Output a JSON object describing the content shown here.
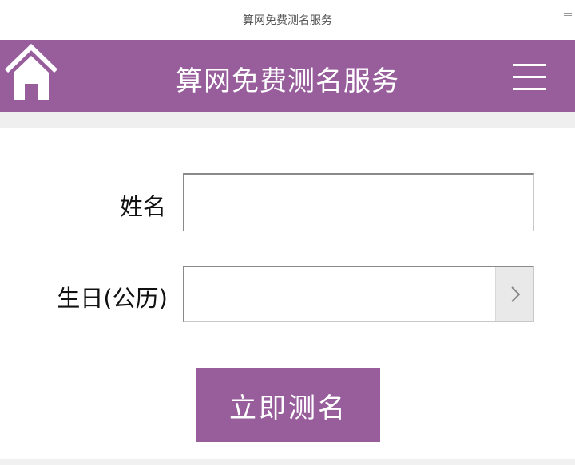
{
  "browser": {
    "title": "算网免费测名服务"
  },
  "header": {
    "title": "算网免费测名服务",
    "home_icon": "home-icon",
    "menu_icon": "hamburger-menu-icon",
    "color": "#985e9c"
  },
  "form": {
    "name_label": "姓名",
    "name_value": "",
    "birthday_label": "生日(公历)",
    "birthday_value": "",
    "picker_icon": "chevron-right-icon"
  },
  "submit": {
    "label": "立即测名",
    "color": "#985e9c"
  }
}
